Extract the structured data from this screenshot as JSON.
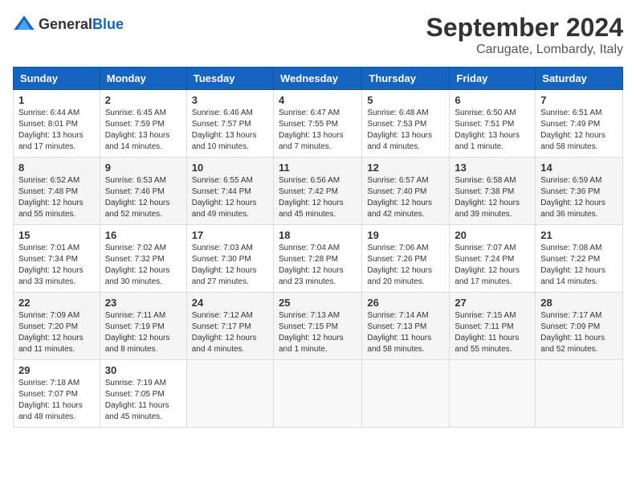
{
  "header": {
    "logo_general": "General",
    "logo_blue": "Blue",
    "month": "September 2024",
    "location": "Carugate, Lombardy, Italy"
  },
  "days_of_week": [
    "Sunday",
    "Monday",
    "Tuesday",
    "Wednesday",
    "Thursday",
    "Friday",
    "Saturday"
  ],
  "weeks": [
    [
      {
        "day": "1",
        "sunrise": "6:44 AM",
        "sunset": "8:01 PM",
        "daylight": "13 hours and 17 minutes."
      },
      {
        "day": "2",
        "sunrise": "6:45 AM",
        "sunset": "7:59 PM",
        "daylight": "13 hours and 14 minutes."
      },
      {
        "day": "3",
        "sunrise": "6:46 AM",
        "sunset": "7:57 PM",
        "daylight": "13 hours and 10 minutes."
      },
      {
        "day": "4",
        "sunrise": "6:47 AM",
        "sunset": "7:55 PM",
        "daylight": "13 hours and 7 minutes."
      },
      {
        "day": "5",
        "sunrise": "6:48 AM",
        "sunset": "7:53 PM",
        "daylight": "13 hours and 4 minutes."
      },
      {
        "day": "6",
        "sunrise": "6:50 AM",
        "sunset": "7:51 PM",
        "daylight": "13 hours and 1 minute."
      },
      {
        "day": "7",
        "sunrise": "6:51 AM",
        "sunset": "7:49 PM",
        "daylight": "12 hours and 58 minutes."
      }
    ],
    [
      {
        "day": "8",
        "sunrise": "6:52 AM",
        "sunset": "7:48 PM",
        "daylight": "12 hours and 55 minutes."
      },
      {
        "day": "9",
        "sunrise": "6:53 AM",
        "sunset": "7:46 PM",
        "daylight": "12 hours and 52 minutes."
      },
      {
        "day": "10",
        "sunrise": "6:55 AM",
        "sunset": "7:44 PM",
        "daylight": "12 hours and 49 minutes."
      },
      {
        "day": "11",
        "sunrise": "6:56 AM",
        "sunset": "7:42 PM",
        "daylight": "12 hours and 45 minutes."
      },
      {
        "day": "12",
        "sunrise": "6:57 AM",
        "sunset": "7:40 PM",
        "daylight": "12 hours and 42 minutes."
      },
      {
        "day": "13",
        "sunrise": "6:58 AM",
        "sunset": "7:38 PM",
        "daylight": "12 hours and 39 minutes."
      },
      {
        "day": "14",
        "sunrise": "6:59 AM",
        "sunset": "7:36 PM",
        "daylight": "12 hours and 36 minutes."
      }
    ],
    [
      {
        "day": "15",
        "sunrise": "7:01 AM",
        "sunset": "7:34 PM",
        "daylight": "12 hours and 33 minutes."
      },
      {
        "day": "16",
        "sunrise": "7:02 AM",
        "sunset": "7:32 PM",
        "daylight": "12 hours and 30 minutes."
      },
      {
        "day": "17",
        "sunrise": "7:03 AM",
        "sunset": "7:30 PM",
        "daylight": "12 hours and 27 minutes."
      },
      {
        "day": "18",
        "sunrise": "7:04 AM",
        "sunset": "7:28 PM",
        "daylight": "12 hours and 23 minutes."
      },
      {
        "day": "19",
        "sunrise": "7:06 AM",
        "sunset": "7:26 PM",
        "daylight": "12 hours and 20 minutes."
      },
      {
        "day": "20",
        "sunrise": "7:07 AM",
        "sunset": "7:24 PM",
        "daylight": "12 hours and 17 minutes."
      },
      {
        "day": "21",
        "sunrise": "7:08 AM",
        "sunset": "7:22 PM",
        "daylight": "12 hours and 14 minutes."
      }
    ],
    [
      {
        "day": "22",
        "sunrise": "7:09 AM",
        "sunset": "7:20 PM",
        "daylight": "12 hours and 11 minutes."
      },
      {
        "day": "23",
        "sunrise": "7:11 AM",
        "sunset": "7:19 PM",
        "daylight": "12 hours and 8 minutes."
      },
      {
        "day": "24",
        "sunrise": "7:12 AM",
        "sunset": "7:17 PM",
        "daylight": "12 hours and 4 minutes."
      },
      {
        "day": "25",
        "sunrise": "7:13 AM",
        "sunset": "7:15 PM",
        "daylight": "12 hours and 1 minute."
      },
      {
        "day": "26",
        "sunrise": "7:14 AM",
        "sunset": "7:13 PM",
        "daylight": "11 hours and 58 minutes."
      },
      {
        "day": "27",
        "sunrise": "7:15 AM",
        "sunset": "7:11 PM",
        "daylight": "11 hours and 55 minutes."
      },
      {
        "day": "28",
        "sunrise": "7:17 AM",
        "sunset": "7:09 PM",
        "daylight": "11 hours and 52 minutes."
      }
    ],
    [
      {
        "day": "29",
        "sunrise": "7:18 AM",
        "sunset": "7:07 PM",
        "daylight": "11 hours and 48 minutes."
      },
      {
        "day": "30",
        "sunrise": "7:19 AM",
        "sunset": "7:05 PM",
        "daylight": "11 hours and 45 minutes."
      },
      null,
      null,
      null,
      null,
      null
    ]
  ]
}
